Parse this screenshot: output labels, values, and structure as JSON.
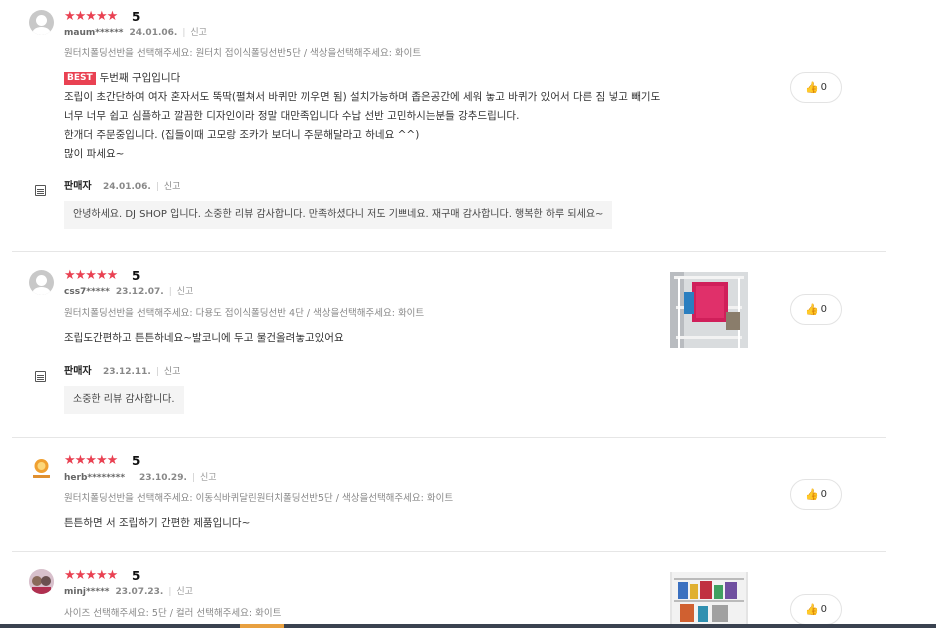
{
  "reviews": [
    {
      "rating_text": "5",
      "stars": "★★★★★",
      "user": "maum******",
      "date": "24.01.06.",
      "sep": "|",
      "report": "신고",
      "option": "원터치폴딩선반을 선택해주세요: 원터치 접이식폴딩선반5단 / 색상을선택해주세요: 화이트",
      "best_badge": "BEST",
      "lines": [
        "두번째 구입입니다",
        "조립이 초간단하여 여자 혼자서도 뚝딱(펼쳐서 바퀴만 끼우면 됨) 설치가능하며 좁은공간에 세워 놓고 바퀴가 있어서 다른 짐 넣고 빼기도",
        "너무 너무 쉽고 심플하고 깔끔한 디자인이라 정말 대만족입니다 수납 선반 고민하시는분들 강추드립니다.",
        "한개더 주문중입니다. (집들이때 고모랑 조카가 보더니 주문해달라고 하네요 ^^)",
        "많이 파세요~"
      ],
      "like_count": "0",
      "seller": {
        "name": "판매자",
        "date": "24.01.06.",
        "report": "신고",
        "reply": "안녕하세요. DJ SHOP 입니다. 소중한 리뷰 감사합니다. 만족하셨다니 저도 기쁘네요. 재구매 감사합니다. 행복한 하루 되세요~"
      }
    },
    {
      "rating_text": "5",
      "stars": "★★★★★",
      "user": "css7*****",
      "date": "23.12.07.",
      "sep": "|",
      "report": "신고",
      "option": "원터치폴딩선반을 선택해주세요: 다용도 접이식폴딩선반 4단 / 색상을선택해주세요: 화이트",
      "lines": [
        "조립도간편하고 튼튼하네요~발코니에 두고 물건올려놓고있어요"
      ],
      "like_count": "0",
      "seller": {
        "name": "판매자",
        "date": "23.12.11.",
        "report": "신고",
        "reply": "소중한 리뷰 감사합니다."
      }
    },
    {
      "rating_text": "5",
      "stars": "★★★★★",
      "user": "herb********",
      "date": "23.10.29.",
      "sep": "|",
      "report": "신고",
      "option": "원터치폴딩선반을 선택해주세요: 이동식바퀴달린원터치폴딩선반5단 / 색상을선택해주세요: 화이트",
      "lines": [
        "튼튼하면 서 조립하기 간편한 제품입니다~"
      ],
      "like_count": "0"
    },
    {
      "rating_text": "5",
      "stars": "★★★★★",
      "user": "minj*****",
      "date": "23.07.23.",
      "sep": "|",
      "report": "신고",
      "option": "사이즈 선택해주세요: 5단 / 컬러 선택해주세요: 화이트",
      "lines": [],
      "like_count": "0"
    }
  ],
  "colors": {
    "star": "#e94152",
    "best": "#e94152",
    "bar": "#3a4250"
  },
  "icons": {
    "like": "thumbs-up-icon",
    "seller": "store-icon",
    "avatar": "user-avatar-icon"
  }
}
